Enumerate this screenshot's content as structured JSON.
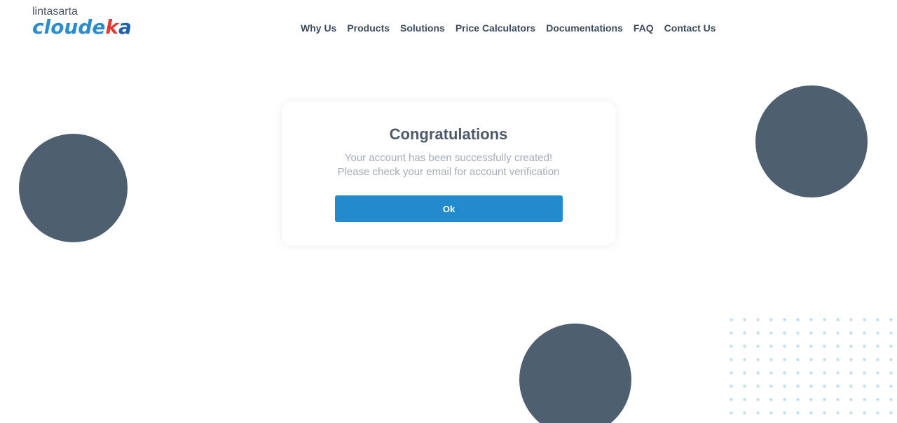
{
  "logo": {
    "top_text": "lintasarta",
    "main_part1": "cloude",
    "main_part2": "k",
    "main_part3": "a",
    "colors": {
      "light_blue": "#2a8bd0",
      "red": "#e53935",
      "dark_blue": "#1f5fa8"
    }
  },
  "nav": {
    "items": [
      {
        "label": "Why Us"
      },
      {
        "label": "Products"
      },
      {
        "label": "Solutions"
      },
      {
        "label": "Price Calculators"
      },
      {
        "label": "Documentations"
      },
      {
        "label": "FAQ"
      },
      {
        "label": "Contact Us"
      }
    ]
  },
  "dialog": {
    "title": "Congratulations",
    "message_line1": "Your account has been successfully created!",
    "message_line2": "Please check your email for account verification",
    "ok_label": "Ok",
    "button_color": "#238ace"
  },
  "decor": {
    "circle_color": "#4e5f70",
    "dot_color": "#bfe0f5"
  }
}
